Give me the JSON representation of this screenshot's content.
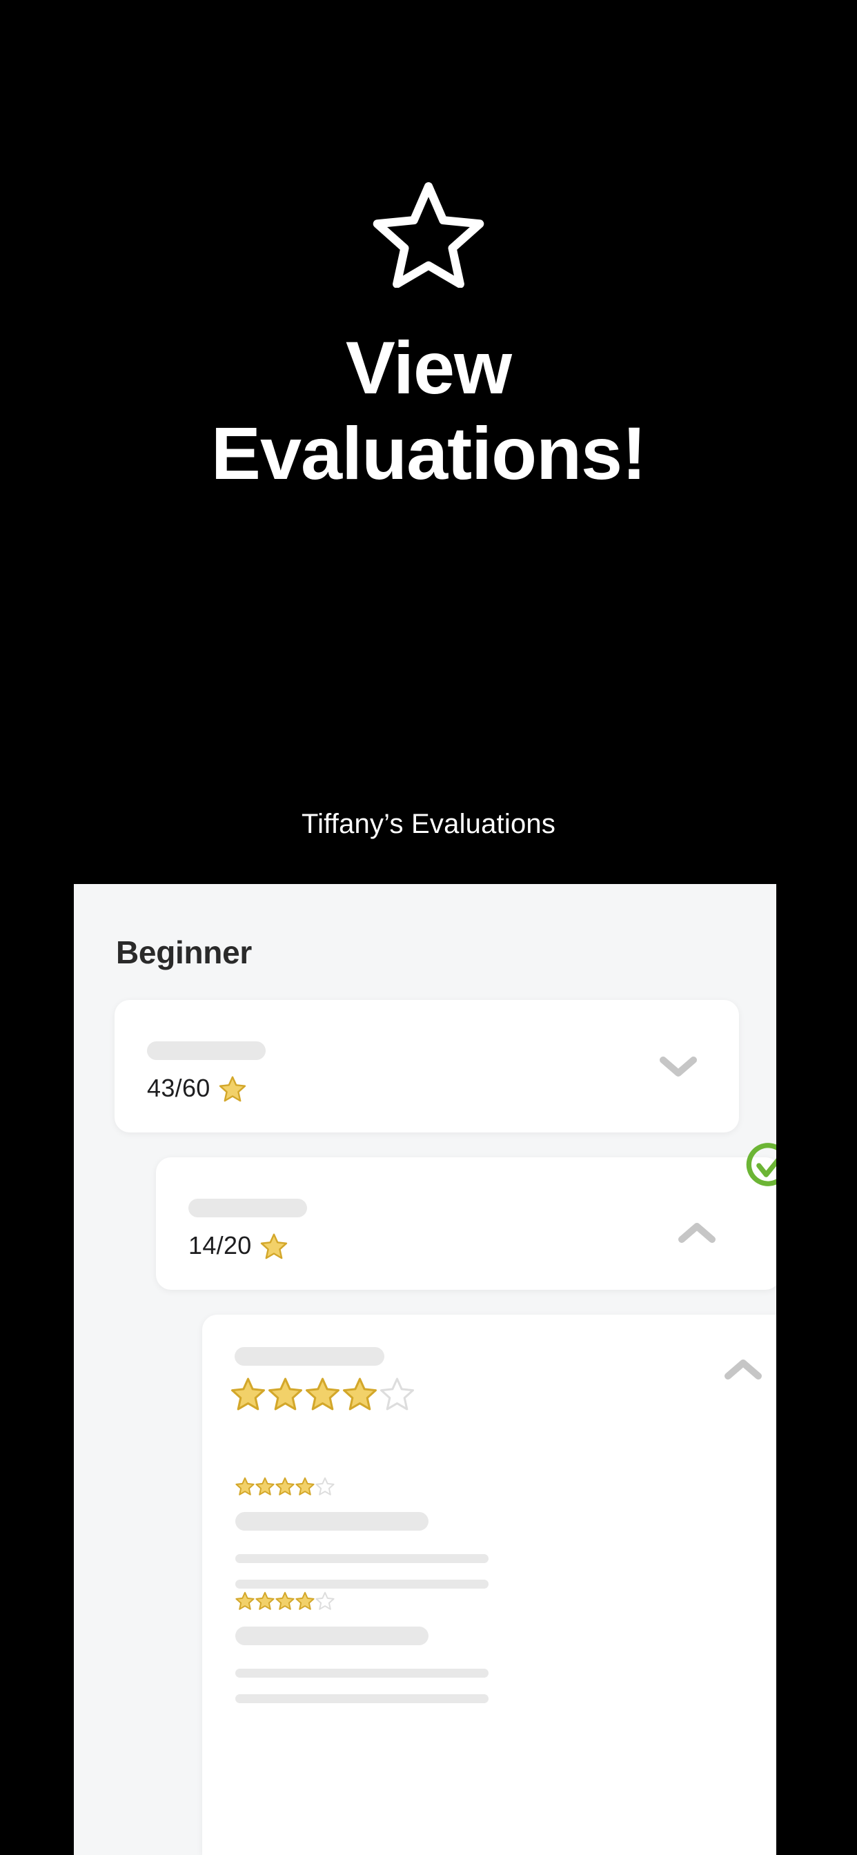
{
  "hero": {
    "icon": "star-outline-icon",
    "title_line1": "View",
    "title_line2": "Evaluations!",
    "subtitle": "Tiffany’s Evaluations"
  },
  "panel": {
    "heading": "Beginner",
    "background_color": "#f5f6f7"
  },
  "colors": {
    "background": "#000000",
    "panel": "#f5f6f7",
    "card": "#ffffff",
    "skeleton": "#e8e8e8",
    "star_fill": "#f0cd58",
    "star_stroke": "#d3a72a",
    "star_empty_stroke": "#dcdcdc",
    "chevron": "#c6c6c6",
    "check_green": "#6cb535",
    "text_dark": "#1d1d1f"
  },
  "cards": [
    {
      "id": "card-level-1",
      "title_placeholder": true,
      "score": "43/60",
      "score_icon": "star-icon",
      "chevron": "chevron-down-icon",
      "expanded": false,
      "completed": false
    },
    {
      "id": "card-level-2",
      "title_placeholder": true,
      "score": "14/20",
      "score_icon": "star-icon",
      "chevron": "chevron-up-icon",
      "expanded": true,
      "completed": true,
      "badge": "check-circle-icon"
    },
    {
      "id": "card-level-3",
      "title_placeholder": true,
      "rating": 4,
      "rating_max": 5,
      "chevron": "chevron-up-icon",
      "expanded": true,
      "reviews": [
        {
          "rating": 4,
          "rating_max": 5,
          "body_placeholder_lines": 3
        },
        {
          "rating": 4,
          "rating_max": 5,
          "body_placeholder_lines": 3
        }
      ]
    }
  ]
}
